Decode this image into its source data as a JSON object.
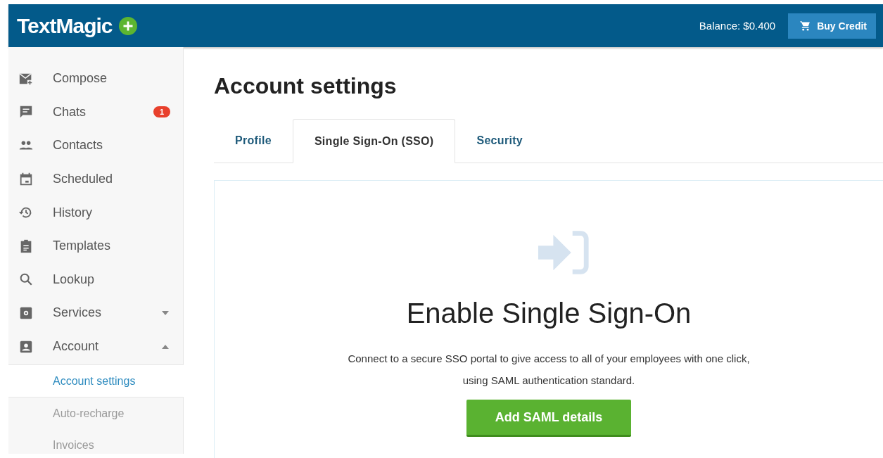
{
  "header": {
    "logo": "TextMagic",
    "balance": "Balance: $0.400",
    "buy_button": "Buy Credit"
  },
  "sidebar": {
    "items": [
      {
        "label": "Compose"
      },
      {
        "label": "Chats",
        "badge": "1"
      },
      {
        "label": "Contacts"
      },
      {
        "label": "Scheduled"
      },
      {
        "label": "History"
      },
      {
        "label": "Templates"
      },
      {
        "label": "Lookup"
      },
      {
        "label": "Services",
        "expanded": false
      },
      {
        "label": "Account",
        "expanded": true,
        "children": [
          {
            "label": "Account settings",
            "selected": true
          },
          {
            "label": "Auto-recharge",
            "selected": false
          },
          {
            "label": "Invoices",
            "selected": false
          }
        ]
      }
    ]
  },
  "page": {
    "title": "Account settings",
    "tabs": [
      {
        "label": "Profile",
        "selected": false
      },
      {
        "label": "Single Sign-On (SSO)",
        "selected": true
      },
      {
        "label": "Security",
        "selected": false
      }
    ],
    "panel": {
      "heading": "Enable Single Sign-On",
      "description": "Connect to a secure SSO portal to give access to all of your employees with one click,",
      "description_2": "using SAML authentication standard.",
      "button": "Add SAML details"
    }
  }
}
